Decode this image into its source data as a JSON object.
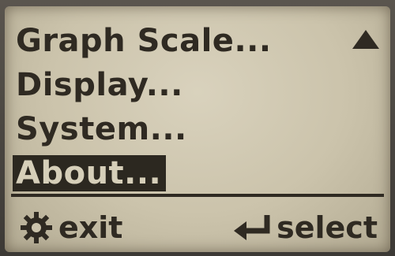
{
  "menu": {
    "items": [
      {
        "label": "Graph Scale..."
      },
      {
        "label": "Display..."
      },
      {
        "label": "System..."
      },
      {
        "label": "About..."
      }
    ],
    "selected_index": 3,
    "scroll_indicator_icon": "triangle-up-icon"
  },
  "softkeys": {
    "left": {
      "icon": "gear-icon",
      "label": "exit"
    },
    "right": {
      "icon": "enter-arrow-icon",
      "label": "select"
    }
  },
  "colors": {
    "lcd_background": "#cbc3ab",
    "lcd_foreground": "#2f2a22"
  }
}
